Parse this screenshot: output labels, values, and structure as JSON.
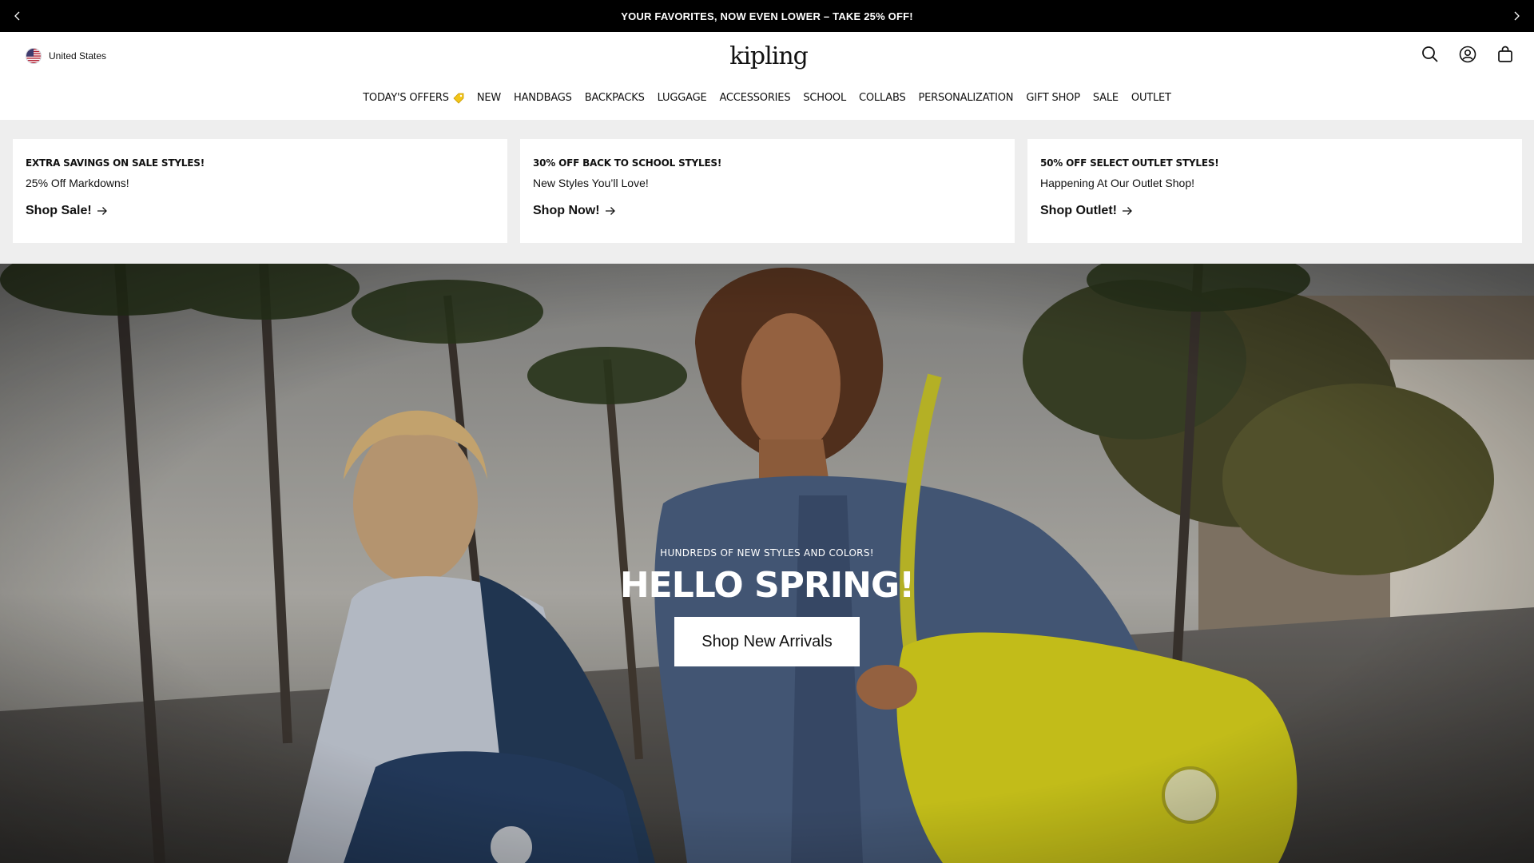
{
  "announcement": {
    "text": "YOUR FAVORITES, NOW EVEN LOWER – TAKE 25% OFF!",
    "prev_icon": "chevron-left-icon",
    "next_icon": "chevron-right-icon"
  },
  "header": {
    "locale_label": "United States",
    "logo_text": "kipling",
    "icons": [
      "search-icon",
      "account-icon",
      "bag-icon"
    ]
  },
  "nav": {
    "items": [
      {
        "label": "TODAY'S OFFERS",
        "icon": "price-tag-icon"
      },
      {
        "label": "NEW"
      },
      {
        "label": "HANDBAGS"
      },
      {
        "label": "BACKPACKS"
      },
      {
        "label": "LUGGAGE"
      },
      {
        "label": "ACCESSORIES"
      },
      {
        "label": "SCHOOL"
      },
      {
        "label": "COLLABS"
      },
      {
        "label": "PERSONALIZATION"
      },
      {
        "label": "GIFT SHOP"
      },
      {
        "label": "SALE"
      },
      {
        "label": "OUTLET"
      }
    ]
  },
  "promos": [
    {
      "title": "EXTRA SAVINGS ON SALE STYLES!",
      "subtitle": "25% Off Markdowns!",
      "link": "Shop Sale!"
    },
    {
      "title": "30% OFF BACK TO SCHOOL STYLES!",
      "subtitle": "New Styles You’ll Love!",
      "link": "Shop Now!"
    },
    {
      "title": "50% OFF SELECT OUTLET STYLES!",
      "subtitle": "Happening At Our Outlet Shop!",
      "link": "Shop Outlet!"
    }
  ],
  "hero": {
    "eyebrow": "HUNDREDS OF NEW STYLES AND COLORS!",
    "title": "HELLO SPRING!",
    "cta": "Shop New Arrivals"
  },
  "colors": {
    "announcement_bg": "#000000",
    "promo_strip_bg": "#eeeeee",
    "bag_yellow": "#d8d21c",
    "denim": "#4a5f80"
  }
}
